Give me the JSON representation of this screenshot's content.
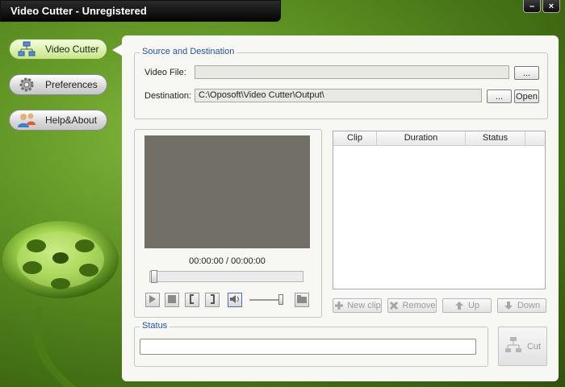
{
  "window": {
    "title": "Video Cutter - Unregistered",
    "minimize": "–",
    "close": "×"
  },
  "nav": [
    {
      "label": "Video Cutter",
      "icon": "video-cutter-icon",
      "active": true
    },
    {
      "label": "Preferences",
      "icon": "gear-icon",
      "active": false
    },
    {
      "label": "Help&About",
      "icon": "users-icon",
      "active": false
    }
  ],
  "source": {
    "group_title": "Source and Destination",
    "video_label": "Video File:",
    "video_value": "",
    "video_browse": "...",
    "dest_label": "Destination:",
    "dest_value": "C:\\Oposoft\\Video Cutter\\Output\\",
    "dest_browse": "...",
    "open": "Open"
  },
  "player": {
    "time": "00:00:00 / 00:00:00",
    "seek_position": 0,
    "volume_level": 0.95
  },
  "clips": {
    "columns": [
      "Clip",
      "Duration",
      "Status"
    ],
    "rows": [],
    "actions": {
      "new": "New clip",
      "remove": "Remove",
      "up": "Up",
      "down": "Down"
    }
  },
  "status": {
    "group_title": "Status",
    "text": ""
  },
  "cut": {
    "label": "Cut"
  },
  "colors": {
    "accent_green": "#6e9b2a",
    "group_title": "#2451a8",
    "screen": "#727066"
  }
}
